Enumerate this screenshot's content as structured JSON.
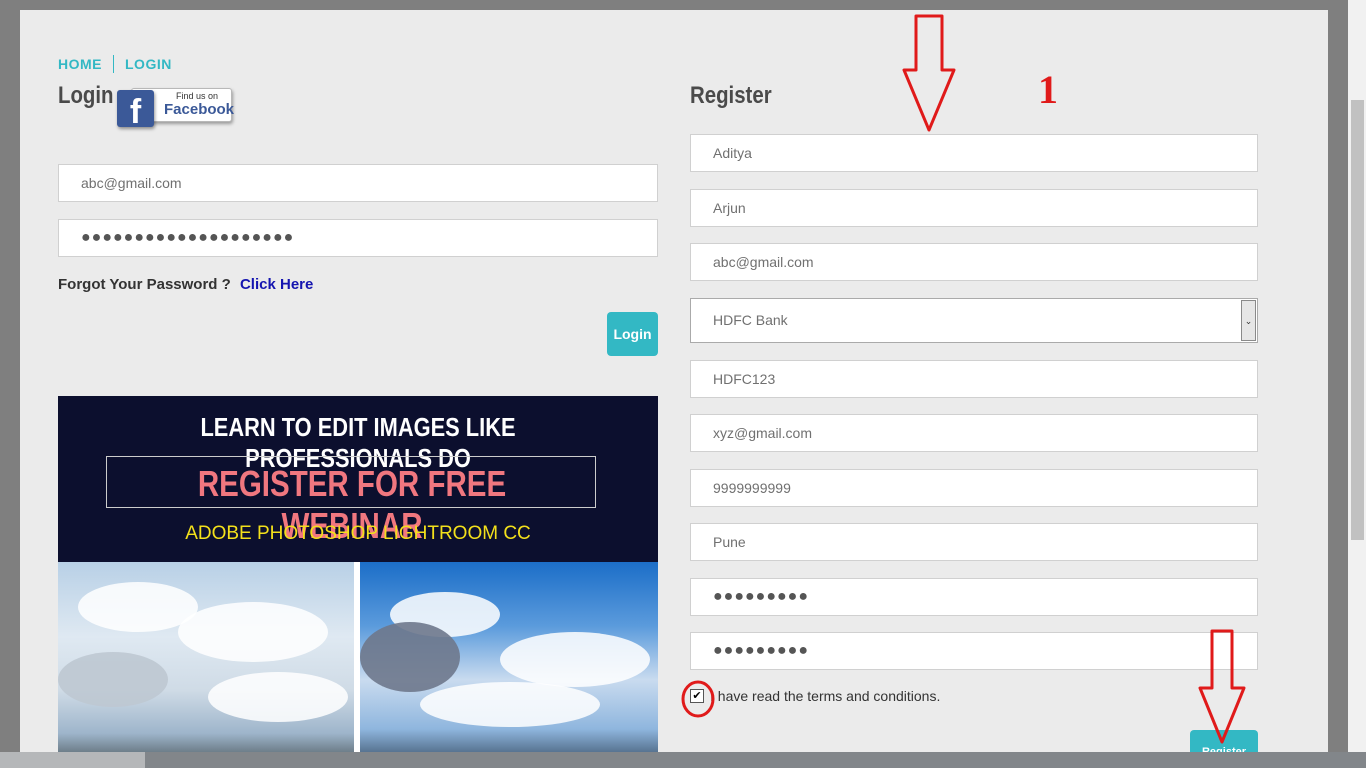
{
  "breadcrumb": {
    "home": "HOME",
    "login": "LOGIN"
  },
  "login": {
    "title": "Login",
    "facebook_small": "Find us on",
    "facebook_big": "Facebook",
    "email_value": "abc@gmail.com",
    "password_value": "●●●●●●●●●●●●●●●●●●●●",
    "forgot_text": "Forgot Your Password ?",
    "forgot_link": "Click Here",
    "login_button": "Login"
  },
  "banner": {
    "line1": "LEARN TO  EDIT IMAGES LIKE PROFESSIONALS DO",
    "line2": "REGISTER FOR FREE WEBINAR",
    "line3": "ADOBE PHOTOSHOP LIGHTROOM CC"
  },
  "register": {
    "title": "Register",
    "first_name": "Aditya",
    "last_name": "Arjun",
    "email": "abc@gmail.com",
    "bank_select": "HDFC Bank",
    "ifsc": "HDFC123",
    "alt_email": "xyz@gmail.com",
    "phone": "9999999999",
    "city": "Pune",
    "password": "●●●●●●●●●",
    "confirm_password": "●●●●●●●●●",
    "terms_label": "I have read the terms and conditions.",
    "terms_checked": true,
    "register_button": "Register"
  },
  "annotation": {
    "step_number": "1",
    "color": "#e01a1a"
  },
  "colors": {
    "accent": "#33b8c4",
    "link": "#1515b0",
    "banner_bg": "#0c0f2e"
  }
}
